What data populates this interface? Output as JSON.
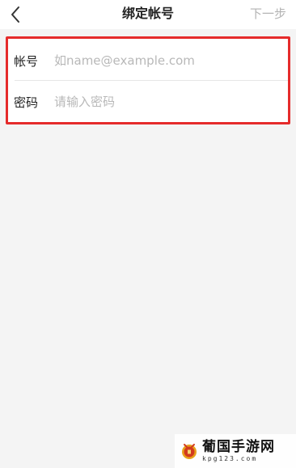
{
  "nav": {
    "back_icon": "chevron-left-icon",
    "title": "绑定帐号",
    "next_label": "下一步"
  },
  "form": {
    "account": {
      "label": "帐号",
      "value": "",
      "placeholder": "如name@example.com"
    },
    "password": {
      "label": "密码",
      "value": "",
      "placeholder": "请输入密码"
    }
  },
  "colors": {
    "highlight_border": "#e52b2b",
    "placeholder": "#b8b8b8",
    "next_disabled": "#b3b3b3",
    "background": "#f4f4f4"
  },
  "watermark": {
    "name": "葡国手游网",
    "domain": "kpg123.com"
  }
}
